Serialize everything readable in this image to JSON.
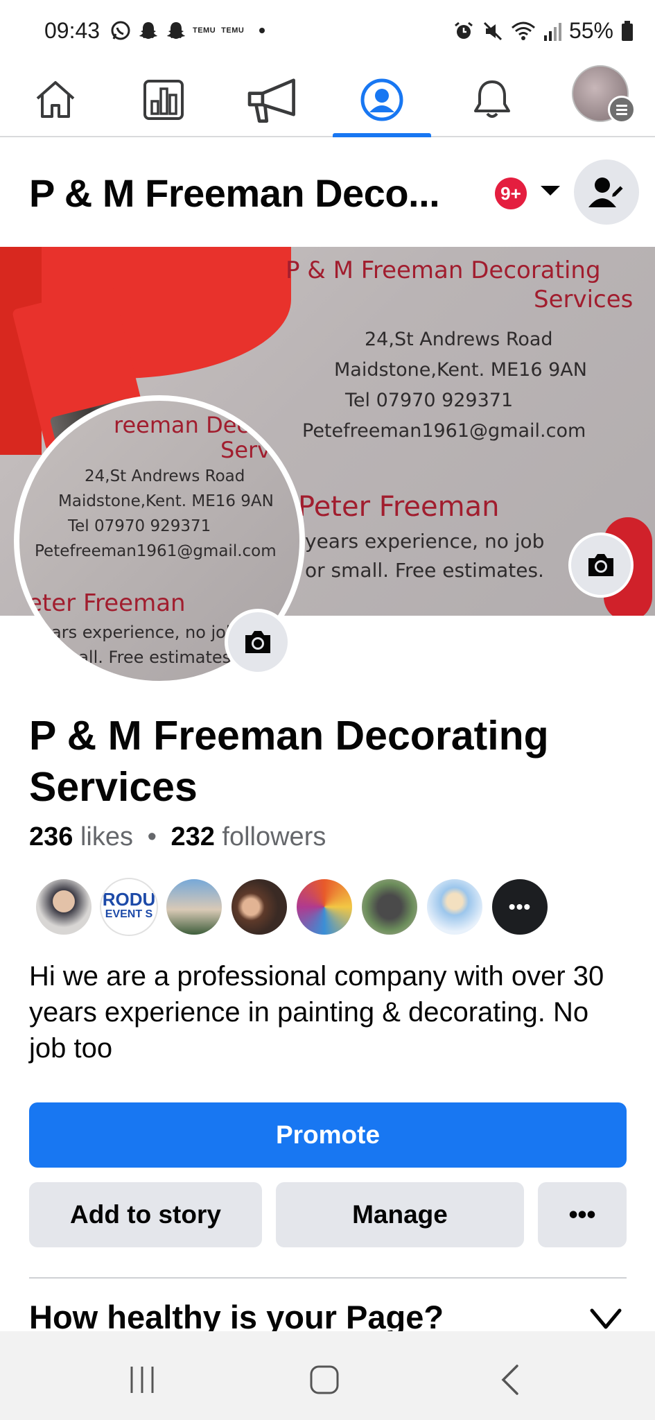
{
  "status_bar": {
    "time": "09:43",
    "temu_label_1": "TEMU",
    "temu_label_2": "TEMU",
    "battery": "55%"
  },
  "top_nav": {
    "tabs": [
      {
        "name": "home",
        "icon": "home-icon"
      },
      {
        "name": "insights",
        "icon": "insights-icon"
      },
      {
        "name": "ads",
        "icon": "megaphone-icon"
      },
      {
        "name": "page-profile",
        "icon": "profile-icon",
        "active": true
      },
      {
        "name": "notifications",
        "icon": "bell-icon"
      },
      {
        "name": "menu",
        "icon": "avatar-menu-icon"
      }
    ],
    "accent_color": "#1877f2"
  },
  "header": {
    "title": "P & M Freeman Deco...",
    "notification_badge": "9+",
    "badge_color": "#e41e3f"
  },
  "cover": {
    "card_title_1": "P & M Freeman Decorating",
    "card_title_2": "Services",
    "address_1": "24,St Andrews Road",
    "address_2": "Maidstone,Kent. ME16 9AN",
    "phone": "Tel 07970 929371",
    "email": "Petefreeman1961@gmail.com",
    "owner": "Peter Freeman",
    "tagline_1": "years experience, no job",
    "tagline_2": "or small. Free estimates."
  },
  "profile_pic": {
    "card_title_1": "reeman Dec",
    "card_title_2": "Serv",
    "address_1": "24,St Andrews Road",
    "address_2": "Maidstone,Kent. ME16 9AN",
    "phone": "Tel 07970 929371",
    "email": "Petefreeman1961@gmail.com",
    "owner": "eter Freeman",
    "tagline_1": "ars experience, no job",
    "tagline_2": "nall. Free estimates."
  },
  "page": {
    "name": "P & M Freeman Decorating Services",
    "likes_count": "236",
    "likes_label": "likes",
    "separator": "•",
    "followers_count": "232",
    "followers_label": "followers",
    "follower_avatar_2_line1": "RODU",
    "follower_avatar_2_line2": "EVENT S",
    "more_followers": "•••",
    "bio": "Hi we are a professional company with over 30 years experience in painting & decorating. No job too"
  },
  "actions": {
    "promote": "Promote",
    "add_to_story": "Add to story",
    "manage": "Manage",
    "more": "•••"
  },
  "health": {
    "title": "How healthy is your Page?"
  }
}
